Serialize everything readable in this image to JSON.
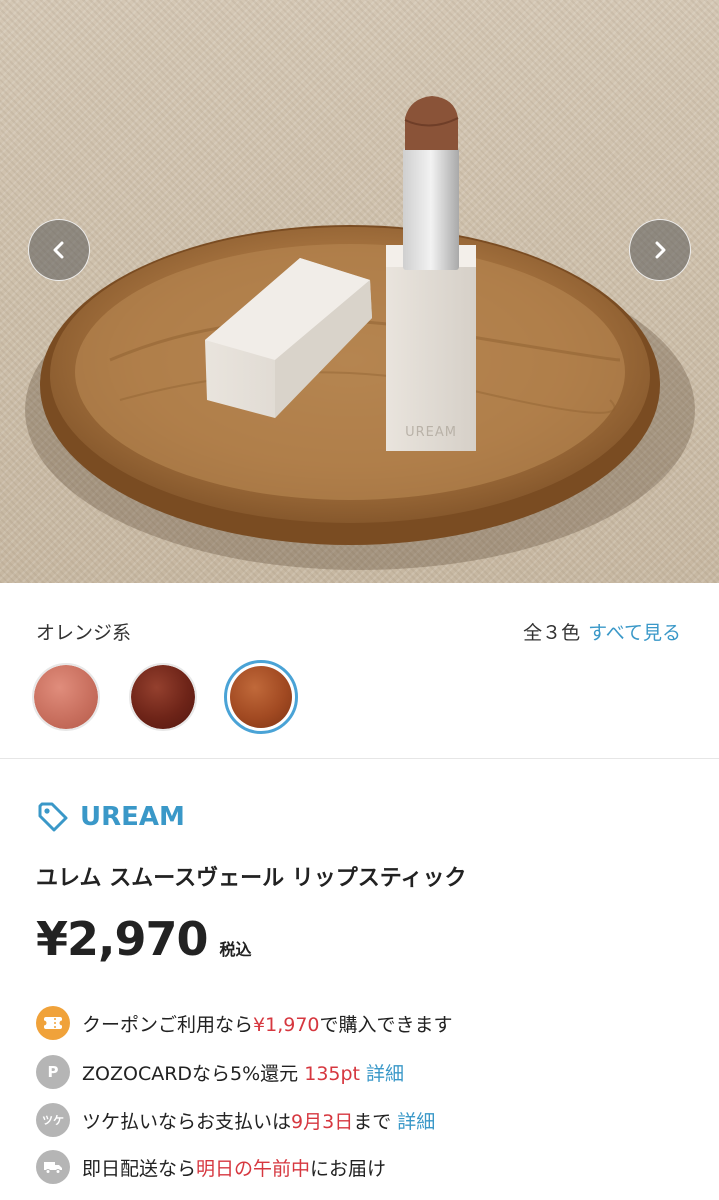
{
  "gallery": {
    "product_mark": "UREAM"
  },
  "colors": {
    "group_label": "オレンジ系",
    "count_label": "全３色",
    "see_all": "すべて見る",
    "swatches": [
      {
        "color": "#c9705f",
        "selected": false
      },
      {
        "color": "#6e2418",
        "selected": false
      },
      {
        "color": "#a24a22",
        "selected": true
      }
    ]
  },
  "product": {
    "brand": "UREAM",
    "name": "ユレム スムースヴェール リップスティック",
    "price": "¥2,970",
    "tax_label": "税込"
  },
  "info": {
    "coupon": {
      "pre": "クーポンご利用なら",
      "price": "¥1,970",
      "post": "で購入できます"
    },
    "card": {
      "pre": "ZOZOCARDなら5%還元 ",
      "points": "135pt",
      "link": "詳細",
      "icon_text": "P"
    },
    "tsuke": {
      "pre": "ツケ払いならお支払いは",
      "date": "9月3日",
      "post": "まで",
      "link": "詳細",
      "icon_text": "ツケ"
    },
    "delivery": {
      "pre": "即日配送なら",
      "when": "明日の午前中",
      "post": "にお届け"
    }
  },
  "theme": {
    "accent": "#3a98c8",
    "sale_red": "#d6373f",
    "coupon_orange": "#f0a23a",
    "icon_gray": "#b5b5b5"
  }
}
